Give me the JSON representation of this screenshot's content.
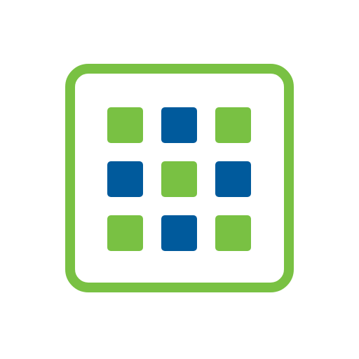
{
  "icon": {
    "name": "grid-apps-icon",
    "frame_color": "#79c143",
    "grid": {
      "rows": 3,
      "cols": 3,
      "tiles": [
        "#79c143",
        "#005a9c",
        "#79c143",
        "#005a9c",
        "#79c143",
        "#005a9c",
        "#79c143",
        "#005a9c",
        "#79c143"
      ]
    }
  }
}
